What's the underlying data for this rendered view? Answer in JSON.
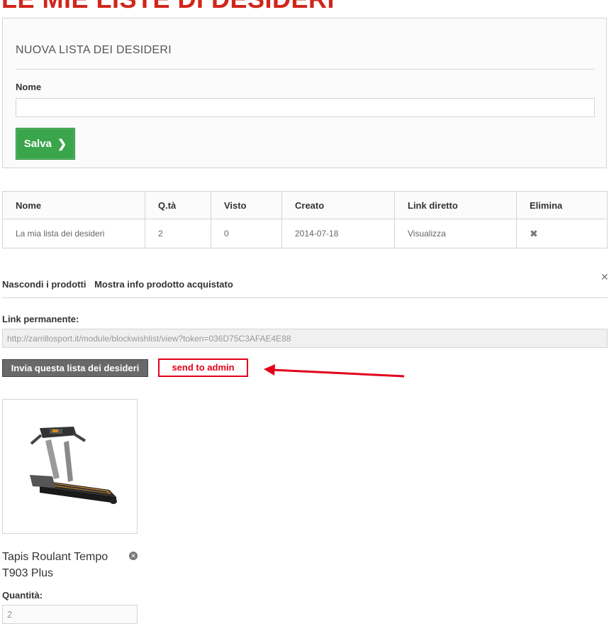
{
  "page": {
    "title": "LE MIE LISTE DI DESIDERI"
  },
  "new_list": {
    "heading": "NUOVA LISTA DEI DESIDERI",
    "name_label": "Nome",
    "name_value": "",
    "save_label": "Salva",
    "save_icon": "chevron-right-icon"
  },
  "table": {
    "headers": [
      "Nome",
      "Q.tà",
      "Visto",
      "Creato",
      "Link diretto",
      "Elimina"
    ],
    "rows": [
      {
        "name": "La mia lista dei desideri",
        "qty": "2",
        "viewed": "0",
        "created": "2014-07-18",
        "link": "Visualizza",
        "delete_icon": "delete-x-icon"
      }
    ]
  },
  "details": {
    "hide_products": "Nascondi i prodotti",
    "show_bought_info": "Mostra info prodotto acquistato",
    "close_icon": "close-icon",
    "permalink_label": "Link permanente:",
    "permalink_value": "http://zarrillosport.it/module/blockwishlist/view?token=036D75C3AFAE4E88",
    "send_label": "Invia questa lista dei desideri"
  },
  "annotation": {
    "text": "send to admin",
    "color": "#e3001b"
  },
  "product": {
    "name": "Tapis Roulant Tempo T903 Plus",
    "remove_icon": "remove-circle-icon",
    "qty_label": "Quantità:",
    "qty_value": "2"
  },
  "colors": {
    "title": "#d0261c",
    "save": "#3aa54a",
    "send": "#696969"
  }
}
